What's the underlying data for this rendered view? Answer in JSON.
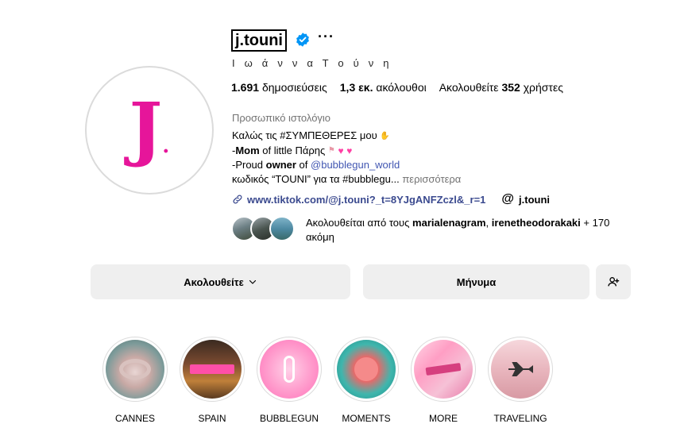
{
  "profile": {
    "username": "j.touni",
    "full_name": "Ι ω ά ν ν α Τ ο ύ ν η",
    "more_dots": "···",
    "avatar_letter": "J",
    "avatar_dot": ".",
    "accent_color": "#e6159a",
    "verified_color": "#0095f6"
  },
  "stats": {
    "posts_count": "1.691",
    "posts_label": "δημοσιεύσεις",
    "followers_count": "1,3 εκ.",
    "followers_label": "ακόλουθοι",
    "following_prefix": "Ακολουθείτε",
    "following_count": "352",
    "following_suffix": "χρήστες"
  },
  "bio": {
    "category": "Προσωπικό ιστολόγιο",
    "line1": "Καλώς τις #ΣΥΜΠΕΘΕΡΕΣ μου",
    "line2_prefix": "-",
    "line2_bold": "Mom",
    "line2_rest": " of little Πάρης",
    "line3_prefix": "-Proud ",
    "line3_bold": "owner",
    "line3_of": " of ",
    "line3_mention": "@bubblegun_world",
    "line4": "κωδικός “TOUNI” για τα #bubblegu...",
    "more_link": "περισσότερα"
  },
  "links": {
    "url": "www.tiktok.com/@j.touni?_t=8YJgANFZczl&_r=1",
    "threads_handle": "j.touni"
  },
  "followed_by": {
    "prefix": "Ακολουθείται από τους",
    "user1": "marialenagram",
    "separator": ",",
    "user2": "irenetheodorakaki",
    "suffix": "+ 170 ακόμη"
  },
  "actions": {
    "follow_label": "Ακολουθείτε",
    "message_label": "Μήνυμα"
  },
  "highlights": [
    {
      "label": "CANNES"
    },
    {
      "label": "SPAIN"
    },
    {
      "label": "BUBBLEGUN"
    },
    {
      "label": "MOMENTS"
    },
    {
      "label": "MORE"
    },
    {
      "label": "TRAVELING"
    }
  ]
}
